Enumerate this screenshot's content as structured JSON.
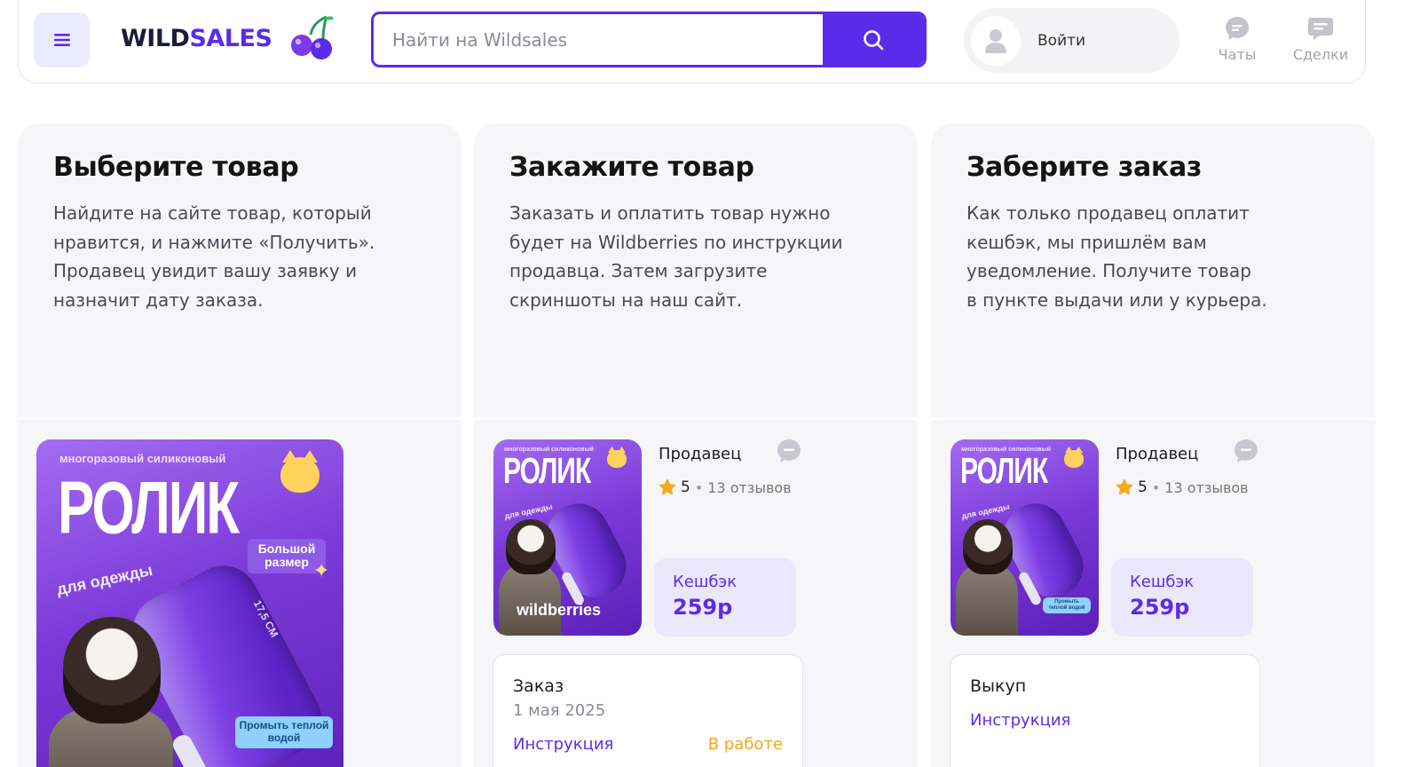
{
  "header": {
    "logo": {
      "part1": "WILD",
      "part2": "SALES"
    },
    "search": {
      "placeholder": "Найти на Wildsales",
      "value": ""
    },
    "login_label": "Войти",
    "actions": [
      {
        "label": "Чаты",
        "icon": "chat-icon"
      },
      {
        "label": "Сделки",
        "icon": "deals-icon"
      }
    ]
  },
  "colors": {
    "accent": "#5b2bea",
    "card_bg": "#f6f6f9",
    "cashback_bg": "#ebe8fc",
    "status_orange": "#f6a21a"
  },
  "product_image": {
    "subtitle": "многоразовый силиконовый",
    "title": "РОЛИК",
    "tilt_text": "для одежды",
    "badge": "Большой размер",
    "note": "Промыть теплой водой",
    "measure": "17,5 СМ",
    "brand": "wildberries"
  },
  "steps": [
    {
      "title": "Выберите товар",
      "lines": [
        "Найдите на сайте товар, который",
        "нравится, и нажмите «Получить».",
        "Продавец увидит вашу заявку и",
        "назначит дату заказа."
      ]
    },
    {
      "title": "Закажите товар",
      "lines": [
        "Заказать и оплатить товар нужно",
        "будет на Wildberries по инструкции",
        "продавца. Затем загрузите",
        "скриншоты на наш сайт."
      ],
      "seller": {
        "name": "Продавец",
        "score": "5",
        "reviews": "13 отзывов"
      },
      "cashback": {
        "label": "Кешбэк",
        "value": "259р"
      },
      "status": {
        "title": "Заказ",
        "date": "1 мая 2025",
        "link": "Инструкция",
        "state": "В работе"
      }
    },
    {
      "title": "Заберите заказ",
      "lines": [
        "Как только продавец оплатит",
        "кешбэк, мы пришлём вам",
        "уведомление. Получите товар",
        "в пункте выдачи или у курьера."
      ],
      "seller": {
        "name": "Продавец",
        "score": "5",
        "reviews": "13 отзывов"
      },
      "cashback": {
        "label": "Кешбэк",
        "value": "259р"
      },
      "status": {
        "title": "Выкуп",
        "link": "Инструкция"
      }
    }
  ]
}
